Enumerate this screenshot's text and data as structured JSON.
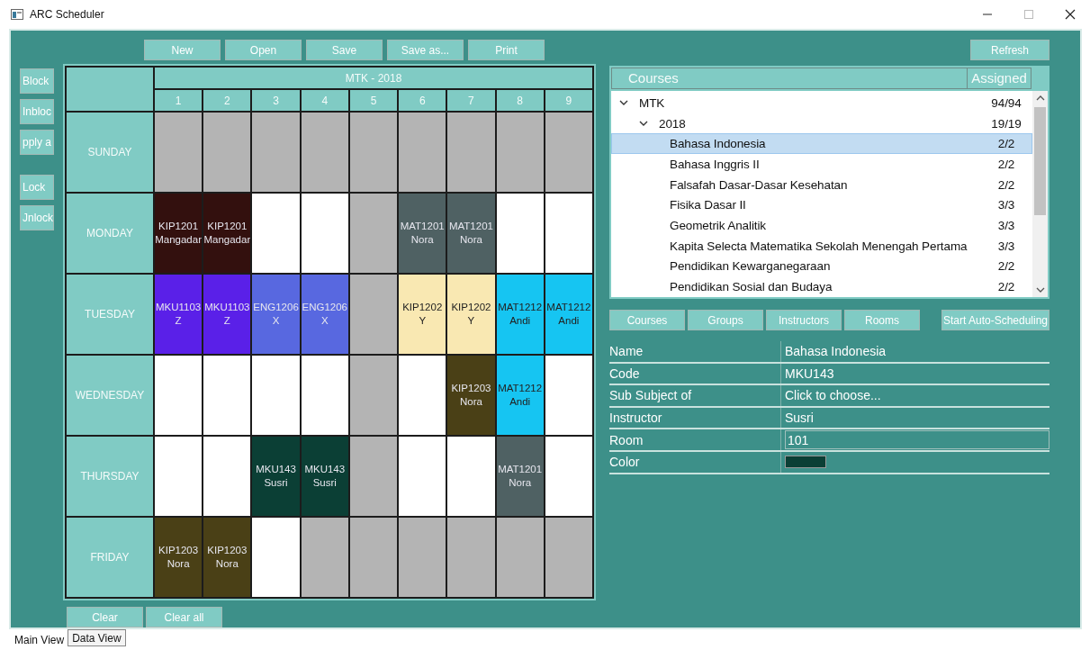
{
  "window": {
    "title": "ARC Scheduler"
  },
  "toolbar": [
    {
      "label": "New"
    },
    {
      "label": "Open"
    },
    {
      "label": "Save"
    },
    {
      "label": "Save as..."
    },
    {
      "label": "Print"
    }
  ],
  "side_buttons": [
    {
      "label": "Block"
    },
    {
      "label": "Inbloc"
    },
    {
      "label": "pply a"
    },
    {
      "label": "Lock"
    },
    {
      "label": "Jnlock"
    }
  ],
  "schedule": {
    "title": "MTK - 2018",
    "periods": [
      "1",
      "2",
      "3",
      "4",
      "5",
      "6",
      "7",
      "8",
      "9"
    ],
    "days": [
      {
        "name": "SUNDAY",
        "slots": [
          {
            "kind": "blocked"
          },
          {
            "kind": "blocked"
          },
          {
            "kind": "blocked"
          },
          {
            "kind": "blocked"
          },
          {
            "kind": "blocked"
          },
          {
            "kind": "blocked"
          },
          {
            "kind": "blocked"
          },
          {
            "kind": "blocked"
          },
          {
            "kind": "blocked"
          }
        ]
      },
      {
        "name": "MONDAY",
        "slots": [
          {
            "kind": "course",
            "code": "KIP1201",
            "instructor": "Mangadar",
            "color": "#33100e"
          },
          {
            "kind": "course",
            "code": "KIP1201",
            "instructor": "Mangadar",
            "color": "#33100e"
          },
          {
            "kind": "empty"
          },
          {
            "kind": "empty"
          },
          {
            "kind": "blocked"
          },
          {
            "kind": "course",
            "code": "MAT1201",
            "instructor": "Nora",
            "color": "#4f6163"
          },
          {
            "kind": "course",
            "code": "MAT1201",
            "instructor": "Nora",
            "color": "#4f6163"
          },
          {
            "kind": "empty"
          },
          {
            "kind": "empty"
          }
        ]
      },
      {
        "name": "TUESDAY",
        "slots": [
          {
            "kind": "course",
            "code": "MKU1103",
            "instructor": "Z",
            "color": "#5a20e8"
          },
          {
            "kind": "course",
            "code": "MKU1103",
            "instructor": "Z",
            "color": "#5a20e8"
          },
          {
            "kind": "course",
            "code": "ENG1206",
            "instructor": "X",
            "color": "#5868e0"
          },
          {
            "kind": "course",
            "code": "ENG1206",
            "instructor": "X",
            "color": "#5868e0"
          },
          {
            "kind": "blocked"
          },
          {
            "kind": "course",
            "code": "KIP1202",
            "instructor": "Y",
            "color": "#f9e8b2"
          },
          {
            "kind": "course",
            "code": "KIP1202",
            "instructor": "Y",
            "color": "#f9e8b2"
          },
          {
            "kind": "course",
            "code": "MAT1212",
            "instructor": "Andi",
            "color": "#16c5f2"
          },
          {
            "kind": "course",
            "code": "MAT1212",
            "instructor": "Andi",
            "color": "#16c5f2"
          }
        ]
      },
      {
        "name": "WEDNESDAY",
        "slots": [
          {
            "kind": "empty"
          },
          {
            "kind": "empty"
          },
          {
            "kind": "empty"
          },
          {
            "kind": "empty"
          },
          {
            "kind": "blocked"
          },
          {
            "kind": "empty"
          },
          {
            "kind": "course",
            "code": "KIP1203",
            "instructor": "Nora",
            "color": "#4a4016"
          },
          {
            "kind": "course",
            "code": "MAT1212",
            "instructor": "Andi",
            "color": "#16c5f2"
          },
          {
            "kind": "empty"
          }
        ]
      },
      {
        "name": "THURSDAY",
        "slots": [
          {
            "kind": "empty"
          },
          {
            "kind": "empty"
          },
          {
            "kind": "course",
            "code": "MKU143",
            "instructor": "Susri",
            "color": "#0b3f35"
          },
          {
            "kind": "course",
            "code": "MKU143",
            "instructor": "Susri",
            "color": "#0b3f35"
          },
          {
            "kind": "blocked"
          },
          {
            "kind": "empty"
          },
          {
            "kind": "empty"
          },
          {
            "kind": "course",
            "code": "MAT1201",
            "instructor": "Nora",
            "color": "#4f6163"
          },
          {
            "kind": "empty"
          }
        ]
      },
      {
        "name": "FRIDAY",
        "slots": [
          {
            "kind": "course",
            "code": "KIP1203",
            "instructor": "Nora",
            "color": "#4a4016"
          },
          {
            "kind": "course",
            "code": "KIP1203",
            "instructor": "Nora",
            "color": "#4a4016"
          },
          {
            "kind": "empty"
          },
          {
            "kind": "blocked"
          },
          {
            "kind": "blocked"
          },
          {
            "kind": "blocked"
          },
          {
            "kind": "blocked"
          },
          {
            "kind": "blocked"
          },
          {
            "kind": "blocked"
          }
        ]
      }
    ]
  },
  "bottom_buttons": [
    {
      "label": "Clear"
    },
    {
      "label": "Clear all"
    }
  ],
  "refresh_button": {
    "label": "Refresh"
  },
  "tree": {
    "columns": [
      "Courses",
      "Assigned"
    ],
    "items": [
      {
        "label": "MTK",
        "assigned": "94/94",
        "expanded": true,
        "selected": false,
        "children": [
          {
            "label": "2018",
            "assigned": "19/19",
            "expanded": true,
            "selected": false,
            "children": [
              {
                "label": "Bahasa Indonesia",
                "assigned": "2/2",
                "selected": true
              },
              {
                "label": "Bahasa Inggris II",
                "assigned": "2/2",
                "selected": false
              },
              {
                "label": "Falsafah Dasar-Dasar Kesehatan",
                "assigned": "2/2",
                "selected": false
              },
              {
                "label": "Fisika Dasar II",
                "assigned": "3/3",
                "selected": false
              },
              {
                "label": "Geometrik Analitik",
                "assigned": "3/3",
                "selected": false
              },
              {
                "label": "Kapita Selecta Matematika Sekolah Menengah Pertama",
                "assigned": "3/3",
                "selected": false
              },
              {
                "label": "Pendidikan Kewarganegaraan",
                "assigned": "2/2",
                "selected": false
              },
              {
                "label": "Pendidikan Sosial dan Budaya",
                "assigned": "2/2",
                "selected": false
              }
            ]
          }
        ]
      }
    ]
  },
  "view_buttons": [
    {
      "label": "Courses"
    },
    {
      "label": "Groups"
    },
    {
      "label": "Instructors"
    },
    {
      "label": "Rooms"
    }
  ],
  "auto_button": {
    "label": "Start Auto-Scheduling"
  },
  "properties": [
    {
      "label": "Name",
      "kind": "text",
      "value": "Bahasa Indonesia"
    },
    {
      "label": "Code",
      "kind": "text",
      "value": "MKU143"
    },
    {
      "label": "Sub Subject of",
      "kind": "text",
      "value": "Click to choose..."
    },
    {
      "label": "Instructor",
      "kind": "text",
      "value": "Susri"
    },
    {
      "label": "Room",
      "kind": "field",
      "value": "101"
    },
    {
      "label": "Color",
      "kind": "color",
      "color": "#0b3f35"
    }
  ],
  "tabs": [
    {
      "label": "Main View",
      "selected": true
    },
    {
      "label": "Data View",
      "selected": false
    }
  ]
}
